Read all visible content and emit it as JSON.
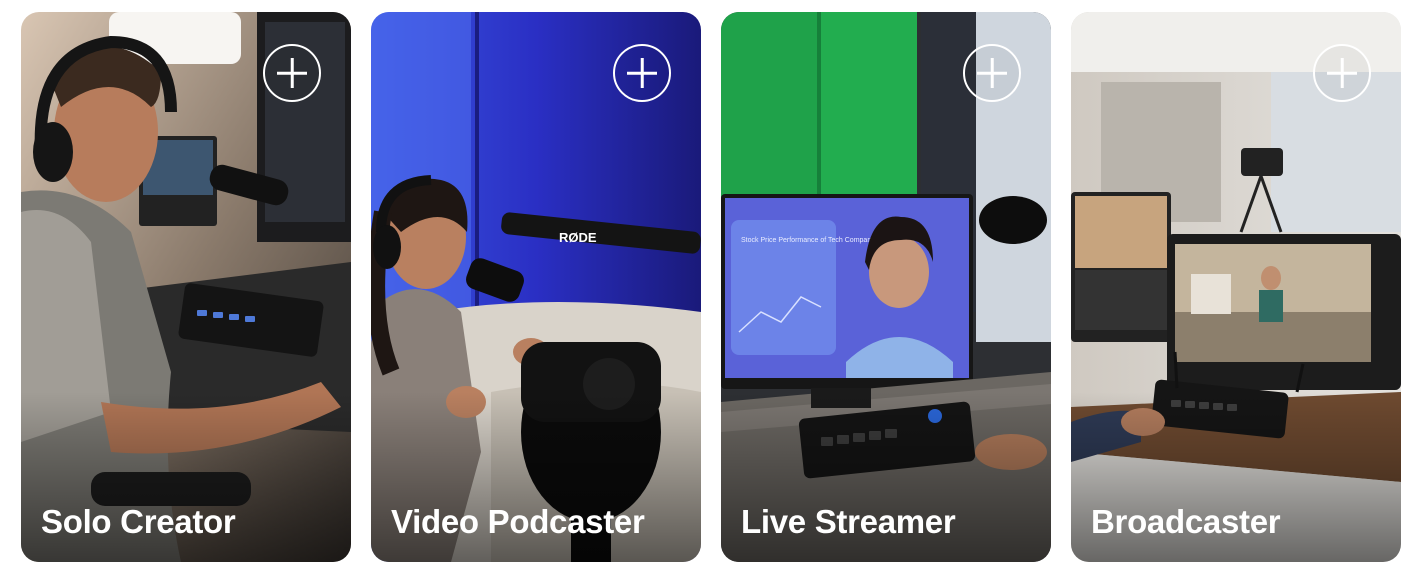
{
  "cards": [
    {
      "title": "Solo Creator",
      "icon": "plus-circle-icon"
    },
    {
      "title": "Video Podcaster",
      "icon": "plus-circle-icon"
    },
    {
      "title": "Live Streamer",
      "icon": "plus-circle-icon"
    },
    {
      "title": "Broadcaster",
      "icon": "plus-circle-icon"
    }
  ],
  "screen_texts": {
    "mic_brand": "RØDE",
    "monitor_headline": "Stock Price Performance of Tech Companies"
  },
  "colors": {
    "title_text": "#ffffff",
    "page_background": "#ffffff"
  }
}
